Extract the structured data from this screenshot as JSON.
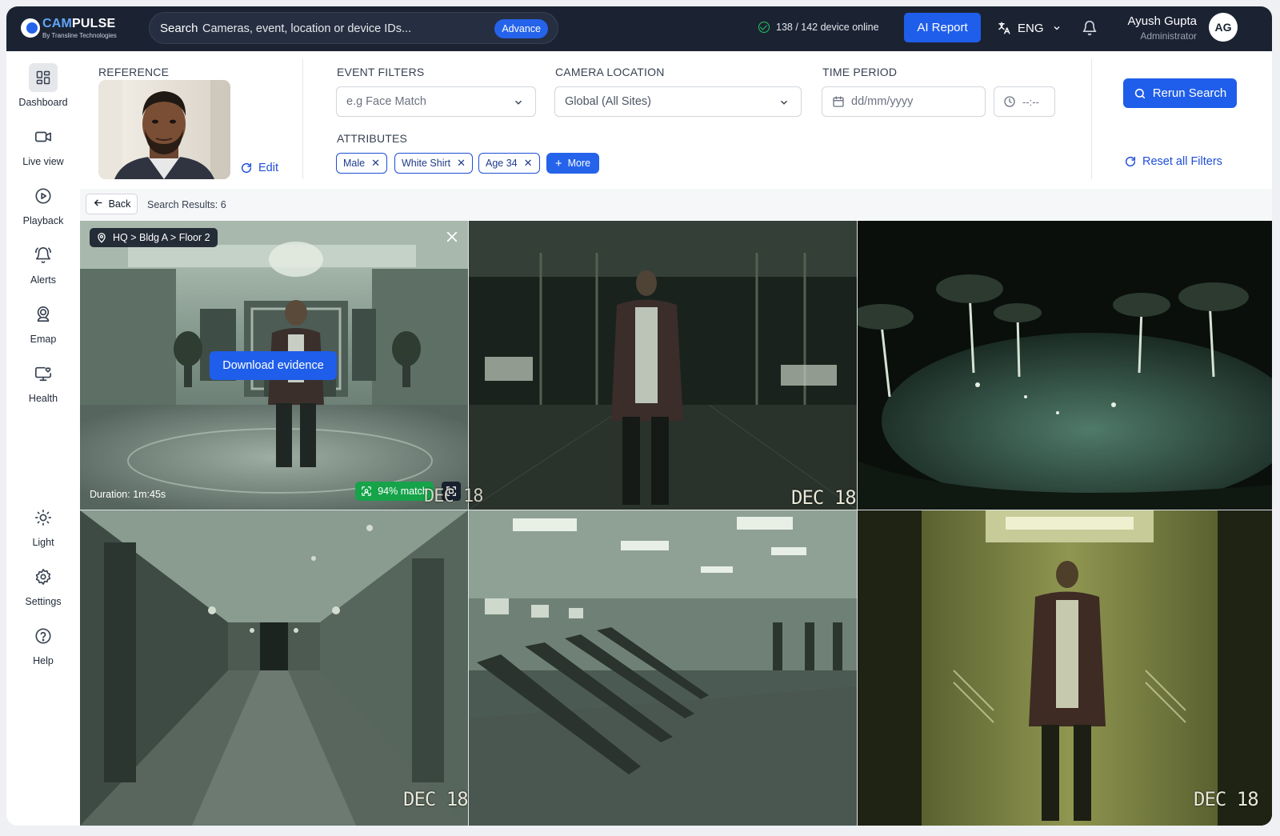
{
  "header": {
    "brand": "CAMPULSE",
    "brand_accent": "CAM",
    "brand_rest": "PULSE",
    "brand_subtitle": "By Transline Technologies",
    "search_label": "Search",
    "search_placeholder": "Cameras, event, location or device IDs...",
    "advance_label": "Advance",
    "device_status": "138 / 142 device online",
    "ai_report_label": "AI Report",
    "language": "ENG",
    "user_name": "Ayush Gupta",
    "user_role": "Administrator",
    "user_initials": "AG"
  },
  "sidebar": {
    "items": [
      {
        "label": "Dashboard",
        "icon": "dashboard-icon",
        "active": true
      },
      {
        "label": "Live view",
        "icon": "video-camera-icon"
      },
      {
        "label": "Playback",
        "icon": "play-circle-icon"
      },
      {
        "label": "Alerts",
        "icon": "bell-icon"
      },
      {
        "label": "Emap",
        "icon": "map-pin-user-icon"
      },
      {
        "label": "Health",
        "icon": "monitor-health-icon"
      }
    ],
    "bottom_items": [
      {
        "label": "Light",
        "icon": "sun-icon"
      },
      {
        "label": "Settings",
        "icon": "gear-icon"
      },
      {
        "label": "Help",
        "icon": "help-circle-icon"
      }
    ]
  },
  "filters": {
    "reference_label": "REFERENCE",
    "edit_label": "Edit",
    "event_filters_label": "EVENT FILTERS",
    "event_filters_placeholder": "e.g Face Match",
    "camera_location_label": "CAMERA LOCATION",
    "camera_location_value": "Global (All Sites)",
    "time_period_label": "TIME PERIOD",
    "date_placeholder": "dd/mm/yyyy",
    "time_placeholder": "--:--",
    "attributes_label": "ATTRIBUTES",
    "attributes": [
      "Male",
      "White Shirt",
      "Age 34"
    ],
    "more_label": "More",
    "rerun_label": "Rerun Search",
    "reset_label": "Reset all Filters"
  },
  "results": {
    "back_label": "Back",
    "count_text": "Search Results: 6",
    "first": {
      "location": "HQ > Bldg A > Floor 2",
      "download_label": "Download evidence",
      "duration": "Duration: 1m:45s",
      "match": "94% match"
    },
    "stamps": [
      "DEC 18",
      "DEC 18",
      "",
      "DEC 18",
      "",
      "DEC 18"
    ],
    "scenes": [
      "hotel-lobby",
      "restaurant-entrance",
      "pool-at-night",
      "hotel-corridor",
      "gym",
      "elevator"
    ]
  },
  "colors": {
    "topbar": "#1b2333",
    "primary": "#1f5eea",
    "match_green": "#16a34a"
  }
}
